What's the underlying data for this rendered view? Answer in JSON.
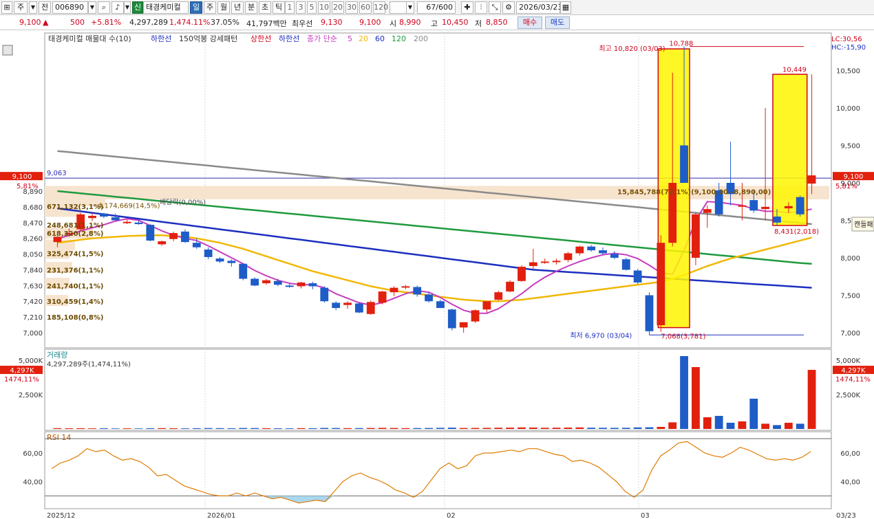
{
  "toolbar": {
    "view_label": "주",
    "prev_label": "전",
    "code": "006890",
    "sin_label": "신",
    "stock_name": "태경케미컬",
    "periods": [
      "일",
      "주",
      "월",
      "년",
      "분",
      "초",
      "틱"
    ],
    "period_active": "일",
    "minute_options": [
      "1",
      "3",
      "5",
      "10",
      "20",
      "30",
      "60",
      "120"
    ],
    "count": "67/600",
    "date": "2026/03/23"
  },
  "pricebar": {
    "price": "9,100",
    "change_arrow": "▲",
    "change": "500",
    "change_pct": "+5.81%",
    "volume": "4,297,289",
    "volume_ratio": "1,474.11%",
    "turnover": "37.05%",
    "amount": "41,797백만",
    "priority_label": "최우선",
    "bid": "9,130",
    "ask": "9,100",
    "open_label": "시",
    "open": "8,990",
    "high_label": "고",
    "high": "10,450",
    "low_label": "저",
    "low": "8,850",
    "buy_label": "매수",
    "sell_label": "매도"
  },
  "legend": {
    "title": "태경케미컬 매물대 수(10)",
    "lower": "하한선",
    "pattern": "150억봉 강세패턴",
    "upper_line": "상한선",
    "lower_line": "하한선",
    "ma_label": "종가 단순",
    "ma_periods": [
      "5",
      "20",
      "60",
      "120",
      "200"
    ],
    "ma_colors": [
      "#c73cc0",
      "#f2b705",
      "#1c2fbf",
      "#1e9a3e",
      "#8a8a8a"
    ]
  },
  "chart_data": [
    {
      "type": "candlestick",
      "title": "",
      "x_labels": [
        "2025/12",
        "2026/01",
        "02",
        "03",
        "03/23"
      ],
      "y_ticks": [
        7000,
        7210,
        7420,
        7630,
        7840,
        8050,
        8260,
        8470,
        8680,
        8890
      ],
      "right_y_ticks": [
        7000,
        7500,
        8000,
        8500,
        9000,
        9500,
        10000,
        10500
      ],
      "candles": [
        {
          "o": 8210,
          "h": 8290,
          "l": 8140,
          "c": 8280
        },
        {
          "o": 8330,
          "h": 8390,
          "l": 8280,
          "c": 8330
        },
        {
          "o": 8380,
          "h": 8600,
          "l": 8360,
          "c": 8580
        },
        {
          "o": 8530,
          "h": 8600,
          "l": 8490,
          "c": 8560
        },
        {
          "o": 8590,
          "h": 8600,
          "l": 8530,
          "c": 8550
        },
        {
          "o": 8540,
          "h": 8590,
          "l": 8500,
          "c": 8500
        },
        {
          "o": 8480,
          "h": 8510,
          "l": 8450,
          "c": 8480
        },
        {
          "o": 8470,
          "h": 8500,
          "l": 8440,
          "c": 8450
        },
        {
          "o": 8440,
          "h": 8450,
          "l": 8220,
          "c": 8230
        },
        {
          "o": 8180,
          "h": 8230,
          "l": 8160,
          "c": 8220
        },
        {
          "o": 8250,
          "h": 8350,
          "l": 8220,
          "c": 8330
        },
        {
          "o": 8350,
          "h": 8380,
          "l": 8200,
          "c": 8210
        },
        {
          "o": 8200,
          "h": 8260,
          "l": 8120,
          "c": 8140
        },
        {
          "o": 8110,
          "h": 8140,
          "l": 7980,
          "c": 8010
        },
        {
          "o": 7990,
          "h": 8010,
          "l": 7930,
          "c": 7950
        },
        {
          "o": 7960,
          "h": 7980,
          "l": 7880,
          "c": 7930
        },
        {
          "o": 7920,
          "h": 7930,
          "l": 7700,
          "c": 7720
        },
        {
          "o": 7720,
          "h": 7740,
          "l": 7620,
          "c": 7630
        },
        {
          "o": 7660,
          "h": 7720,
          "l": 7640,
          "c": 7700
        },
        {
          "o": 7690,
          "h": 7720,
          "l": 7620,
          "c": 7640
        },
        {
          "o": 7630,
          "h": 7660,
          "l": 7600,
          "c": 7620
        },
        {
          "o": 7620,
          "h": 7680,
          "l": 7590,
          "c": 7670
        },
        {
          "o": 7660,
          "h": 7680,
          "l": 7580,
          "c": 7620
        },
        {
          "o": 7600,
          "h": 7620,
          "l": 7400,
          "c": 7420
        },
        {
          "o": 7400,
          "h": 7420,
          "l": 7300,
          "c": 7330
        },
        {
          "o": 7370,
          "h": 7420,
          "l": 7320,
          "c": 7400
        },
        {
          "o": 7390,
          "h": 7400,
          "l": 7260,
          "c": 7270
        },
        {
          "o": 7250,
          "h": 7430,
          "l": 7240,
          "c": 7410
        },
        {
          "o": 7400,
          "h": 7560,
          "l": 7380,
          "c": 7550
        },
        {
          "o": 7540,
          "h": 7620,
          "l": 7490,
          "c": 7600
        },
        {
          "o": 7610,
          "h": 7640,
          "l": 7580,
          "c": 7620
        },
        {
          "o": 7610,
          "h": 7630,
          "l": 7480,
          "c": 7510
        },
        {
          "o": 7510,
          "h": 7540,
          "l": 7400,
          "c": 7420
        },
        {
          "o": 7420,
          "h": 7440,
          "l": 7330,
          "c": 7330
        },
        {
          "o": 7310,
          "h": 7320,
          "l": 7030,
          "c": 7060
        },
        {
          "o": 7070,
          "h": 7140,
          "l": 7000,
          "c": 7140
        },
        {
          "o": 7150,
          "h": 7310,
          "l": 7130,
          "c": 7300
        },
        {
          "o": 7310,
          "h": 7400,
          "l": 7270,
          "c": 7420
        },
        {
          "o": 7440,
          "h": 7560,
          "l": 7430,
          "c": 7540
        },
        {
          "o": 7550,
          "h": 7700,
          "l": 7540,
          "c": 7680
        },
        {
          "o": 7690,
          "h": 7900,
          "l": 7680,
          "c": 7880
        },
        {
          "o": 7890,
          "h": 8120,
          "l": 7850,
          "c": 7940
        },
        {
          "o": 7950,
          "h": 7990,
          "l": 7920,
          "c": 7950
        },
        {
          "o": 7950,
          "h": 7990,
          "l": 7910,
          "c": 7960
        },
        {
          "o": 7970,
          "h": 8080,
          "l": 7940,
          "c": 8060
        },
        {
          "o": 8060,
          "h": 8160,
          "l": 8030,
          "c": 8150
        },
        {
          "o": 8150,
          "h": 8170,
          "l": 8080,
          "c": 8100
        },
        {
          "o": 8100,
          "h": 8140,
          "l": 8040,
          "c": 8060
        },
        {
          "o": 8050,
          "h": 8090,
          "l": 7980,
          "c": 8000
        },
        {
          "o": 7980,
          "h": 8000,
          "l": 7830,
          "c": 7840
        },
        {
          "o": 7830,
          "h": 7850,
          "l": 7650,
          "c": 7670
        },
        {
          "o": 7500,
          "h": 7540,
          "l": 6970,
          "c": 7020
        },
        {
          "o": 7100,
          "h": 8300,
          "l": 7010,
          "c": 8200
        },
        {
          "o": 8200,
          "h": 10470,
          "l": 8150,
          "c": 9000
        },
        {
          "o": 9500,
          "h": 10820,
          "l": 9000,
          "c": 9000
        },
        {
          "o": 8000,
          "h": 8600,
          "l": 7900,
          "c": 8580
        },
        {
          "o": 8600,
          "h": 8700,
          "l": 8400,
          "c": 8650
        },
        {
          "o": 8900,
          "h": 9000,
          "l": 8550,
          "c": 8580
        },
        {
          "o": 9000,
          "h": 9550,
          "l": 8700,
          "c": 8850
        },
        {
          "o": 8700,
          "h": 9000,
          "l": 8500,
          "c": 8700
        },
        {
          "o": 8770,
          "h": 8900,
          "l": 8600,
          "c": 8630
        },
        {
          "o": 8650,
          "h": 10000,
          "l": 8500,
          "c": 8680
        },
        {
          "o": 8550,
          "h": 8650,
          "l": 8431,
          "c": 8470
        },
        {
          "o": 8660,
          "h": 8740,
          "l": 8600,
          "c": 8690
        },
        {
          "o": 8810,
          "h": 8830,
          "l": 8550,
          "c": 8580
        },
        {
          "o": 8990,
          "h": 10449,
          "l": 8850,
          "c": 9100
        }
      ],
      "ma200": [
        9425,
        9410,
        9395,
        9380,
        9365,
        9350,
        9335,
        9320,
        9305,
        9290,
        9275,
        9260,
        9245,
        9230,
        9215,
        9200,
        9185,
        9170,
        9155,
        9140,
        9125,
        9110,
        9095,
        9080,
        9065,
        9050,
        9035,
        9020,
        9005,
        8990,
        8975,
        8960,
        8945,
        8930,
        8915,
        8900,
        8885,
        8870,
        8855,
        8840,
        8825,
        8810,
        8795,
        8780,
        8765,
        8750,
        8735,
        8720,
        8705,
        8690,
        8675,
        8660,
        8645,
        8630,
        8615,
        8600,
        8585,
        8570,
        8555,
        8540,
        8525,
        8510,
        8495,
        8480,
        8465,
        8450
      ],
      "ma120": [
        8890,
        8875,
        8860,
        8845,
        8830,
        8815,
        8800,
        8785,
        8770,
        8755,
        8740,
        8725,
        8710,
        8695,
        8680,
        8665,
        8650,
        8635,
        8620,
        8605,
        8590,
        8575,
        8560,
        8545,
        8530,
        8515,
        8500,
        8485,
        8470,
        8455,
        8440,
        8425,
        8410,
        8395,
        8380,
        8365,
        8350,
        8335,
        8320,
        8305,
        8290,
        8275,
        8260,
        8245,
        8230,
        8215,
        8200,
        8185,
        8170,
        8155,
        8140,
        8125,
        8110,
        8095,
        8080,
        8065,
        8050,
        8035,
        8020,
        8005,
        7990,
        7975,
        7960,
        7945,
        7930,
        7920
      ],
      "ma60": [
        8660,
        8640,
        8620,
        8600,
        8580,
        8560,
        8540,
        8520,
        8500,
        8480,
        8460,
        8440,
        8420,
        8400,
        8380,
        8360,
        8340,
        8320,
        8300,
        8280,
        8260,
        8240,
        8220,
        8200,
        8180,
        8160,
        8140,
        8120,
        8100,
        8080,
        8060,
        8040,
        8020,
        8000,
        7980,
        7960,
        7940,
        7920,
        7900,
        7880,
        7860,
        7840,
        7830,
        7820,
        7810,
        7800,
        7790,
        7780,
        7770,
        7760,
        7750,
        7740,
        7730,
        7720,
        7710,
        7700,
        7690,
        7680,
        7670,
        7660,
        7650,
        7640,
        7630,
        7620,
        7610,
        7600
      ],
      "ma20": [
        8200,
        8220,
        8240,
        8260,
        8270,
        8280,
        8290,
        8295,
        8300,
        8300,
        8290,
        8280,
        8260,
        8230,
        8200,
        8160,
        8120,
        8070,
        8020,
        7970,
        7920,
        7870,
        7820,
        7780,
        7740,
        7700,
        7660,
        7620,
        7590,
        7560,
        7540,
        7520,
        7500,
        7480,
        7460,
        7440,
        7430,
        7420,
        7420,
        7430,
        7440,
        7460,
        7480,
        7500,
        7520,
        7540,
        7560,
        7580,
        7600,
        7620,
        7640,
        7660,
        7680,
        7720,
        7770,
        7830,
        7890,
        7940,
        7990,
        8030,
        8070,
        8110,
        8150,
        8190,
        8230,
        8270
      ],
      "ma5": [
        8250,
        8300,
        8360,
        8400,
        8440,
        8490,
        8520,
        8500,
        8430,
        8360,
        8300,
        8260,
        8230,
        8160,
        8080,
        8000,
        7920,
        7830,
        7760,
        7700,
        7660,
        7640,
        7640,
        7600,
        7520,
        7460,
        7400,
        7370,
        7400,
        7460,
        7520,
        7560,
        7540,
        7470,
        7380,
        7300,
        7260,
        7260,
        7320,
        7420,
        7520,
        7640,
        7740,
        7820,
        7890,
        7950,
        8000,
        8040,
        8060,
        8040,
        7990,
        7900,
        7800,
        7780,
        8100,
        8500,
        8750,
        8740,
        8720,
        8700,
        8650,
        8620,
        8620,
        8600,
        8620,
        8650
      ],
      "volume_ticks": [
        "5,000K",
        "2,500K"
      ],
      "volumes_k": [
        60,
        50,
        55,
        45,
        50,
        40,
        45,
        40,
        55,
        60,
        50,
        45,
        55,
        65,
        60,
        50,
        70,
        65,
        55,
        50,
        45,
        60,
        55,
        75,
        70,
        60,
        65,
        70,
        80,
        70,
        60,
        65,
        70,
        80,
        95,
        70,
        75,
        80,
        90,
        95,
        110,
        100,
        85,
        90,
        100,
        110,
        90,
        85,
        80,
        85,
        110,
        120,
        150,
        480,
        5300,
        4500,
        850,
        950,
        450,
        550,
        2200,
        380,
        280,
        450,
        380,
        4297
      ],
      "rsi_ticks": [
        "60,00",
        "40,00"
      ],
      "rsi": [
        49,
        53,
        55,
        58,
        63,
        61,
        62,
        58,
        55,
        56,
        54,
        50,
        44,
        45,
        41,
        37,
        35,
        33,
        31,
        30,
        30,
        32,
        30,
        32,
        30,
        28,
        29,
        27,
        25,
        26,
        27,
        26,
        33,
        40,
        44,
        46,
        43,
        41,
        38,
        34,
        32,
        29,
        33,
        41,
        49,
        53,
        49,
        51,
        58,
        60,
        60,
        61,
        62,
        61,
        63,
        63,
        61,
        59,
        58,
        54,
        55,
        53,
        50,
        45,
        40,
        33,
        29,
        34,
        48,
        58,
        62,
        67,
        68,
        64,
        60,
        58,
        57,
        60,
        64,
        62,
        59,
        56,
        55,
        56,
        55,
        57,
        61
      ]
    }
  ],
  "annotations": {
    "max_label": "최고 10,820 (03/03)",
    "max_top": "10,788",
    "min_label": "최저 6,970 (03/04)",
    "min_bottom": "7,068(3,781)",
    "box2_top": "10,449",
    "box2_bottom": "8,431(2,018)",
    "div_label": "배당락(0,00%)",
    "volume_text": "4,174,669(14,5%)",
    "big_volume": "15,845,788(72.1%)(9,100,00~8,890,00)",
    "ref_line_label": "9,063",
    "current_price_tag": "9,100",
    "current_pct_tag": "5,81%",
    "lc_label": "LC:30,56",
    "hc_label": "HC:-15,90",
    "candle_pattern": "캔들패",
    "volume_title": "거래량",
    "volume_value": "4,297,289주(1,474,11%)",
    "volume_tag": "4,297K",
    "volume_pct_tag": "1474,11%",
    "rsi_title": "RSI 14",
    "profile_labels": [
      "671,132(3,1%)",
      "248,681(1,1%)",
      "618,320(2,8%)",
      "325,474(1,5%)",
      "231,376(1,1%)",
      "241,740(1,1%)",
      "310,459(1,4%)",
      "185,108(0,8%)"
    ]
  }
}
